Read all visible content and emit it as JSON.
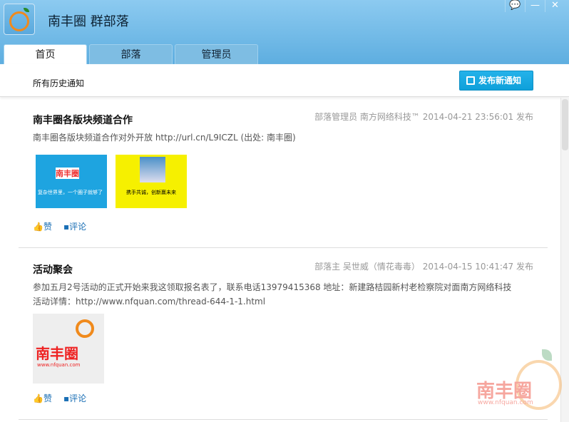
{
  "window": {
    "title": "南丰圈 群部落",
    "controls": [
      "chat-icon",
      "minimize-icon",
      "close-icon"
    ]
  },
  "tabs": [
    {
      "label": "首页",
      "active": true
    },
    {
      "label": "部落"
    },
    {
      "label": "管理员"
    }
  ],
  "subbar": {
    "label": "所有历史通知",
    "publish_button": "发布新通知"
  },
  "posts": [
    {
      "title": "南丰圈各版块频道合作",
      "meta": "部落管理员 南方网络科技™ 2014-04-21 23:56:01 发布",
      "body": "南丰圈各版块频道合作对外开放 http://url.cn/L9ICZL (出处: 南丰圈)",
      "image": {
        "logo_text": "南丰圈",
        "left_caption": "复杂世界里，一个圈子就够了",
        "right_caption": "携手共诚，创新赢未来"
      },
      "like": "赞",
      "comment": "评论"
    },
    {
      "title": "活动聚会",
      "meta": "部落主 吴世威（情花毒毒） 2014-04-15 10:41:47 发布",
      "body_lines": [
        "参加五月2号活动的正式开始来我这领取报名表了，联系电话13979415368 地址：新建路桔园新村老检察院对面南方网络科技",
        "活动详情：http://www.nfquan.com/thread-644-1-1.html"
      ],
      "image": {
        "logo_text": "南丰圈",
        "url": "www.nfquan.com"
      },
      "like": "赞",
      "comment": "评论"
    }
  ],
  "watermark": {
    "text": "南丰圈",
    "url": "www.nfquan.com"
  }
}
